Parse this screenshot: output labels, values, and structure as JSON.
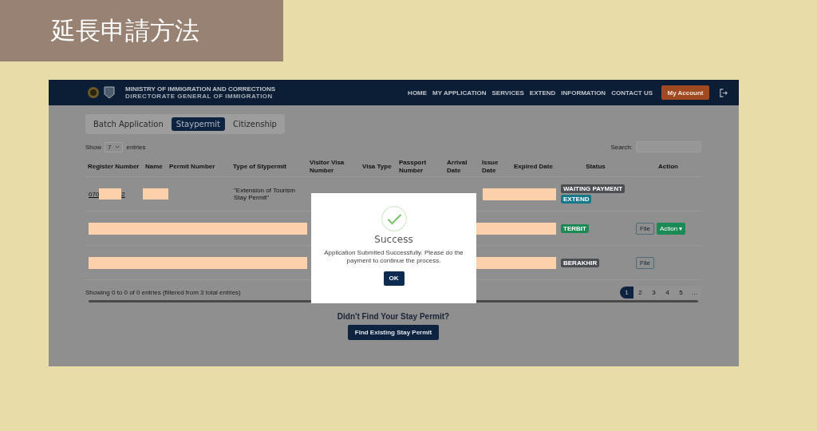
{
  "title_banner": {
    "text": "延長申請方法"
  },
  "navbar": {
    "agency_name": "MINISTRY OF IMMIGRATION AND CORRECTIONS",
    "agency_subtitle": "DIRECTORATE GENERAL OF IMMIGRATION",
    "links": [
      "HOME",
      "MY APPLICATION",
      "SERVICES",
      "EXTEND",
      "INFORMATION",
      "CONTACT US"
    ],
    "account_button": "My Account"
  },
  "tabs": [
    {
      "label": "Batch Application",
      "selected": false
    },
    {
      "label": "Staypermit",
      "selected": true
    },
    {
      "label": "Citizenship",
      "selected": false
    }
  ],
  "show_entries": {
    "prefix": "Show",
    "value": "7",
    "suffix": "entries"
  },
  "search_label": "Search:",
  "table": {
    "columns": [
      "Register Number",
      "Name",
      "Permit Number",
      "Type of Stypermit",
      "Visitor Visa Number",
      "Visa Type",
      "Passport Number",
      "Arrival Date",
      "Issue Date",
      "Expired Date",
      "Status",
      "Action"
    ],
    "rows": [
      {
        "kind": "detail",
        "register_start": "070",
        "register_end": "2",
        "type": "\"Extension of Tourism Stay Permit\"",
        "statuses": [
          {
            "label": "WAITING PAYMENT",
            "color": "#4a4d52"
          },
          {
            "label": "EXTEND",
            "color": "#17788a"
          }
        ],
        "actions": []
      },
      {
        "kind": "masked",
        "statuses": [
          {
            "label": "TERBIT",
            "color": "#1c8a55"
          }
        ],
        "actions": [
          {
            "label": "File",
            "kind": "outline"
          },
          {
            "label": "Action ▾",
            "kind": "solid"
          }
        ]
      },
      {
        "kind": "masked",
        "statuses": [
          {
            "label": "BERAKHIR",
            "color": "#4a4d52"
          }
        ],
        "actions": [
          {
            "label": "File",
            "kind": "outline"
          }
        ]
      }
    ]
  },
  "info": "Showing 0 to 0 of 0 entries (filtered from 3 total entries)",
  "pagination": [
    {
      "label": "1",
      "selected": true
    },
    {
      "label": "2",
      "selected": false
    },
    {
      "label": "3",
      "selected": false
    },
    {
      "label": "4",
      "selected": false
    },
    {
      "label": "5",
      "selected": false
    },
    {
      "label": "…",
      "selected": false
    }
  ],
  "find_section": {
    "heading": "Didn't Find Your Stay Permit?",
    "button": "Find Existing Stay Permit"
  },
  "modal": {
    "title": "Success",
    "message": "Application Submited Successfully. Please do the payment to continue the process.",
    "ok_button": "OK"
  }
}
